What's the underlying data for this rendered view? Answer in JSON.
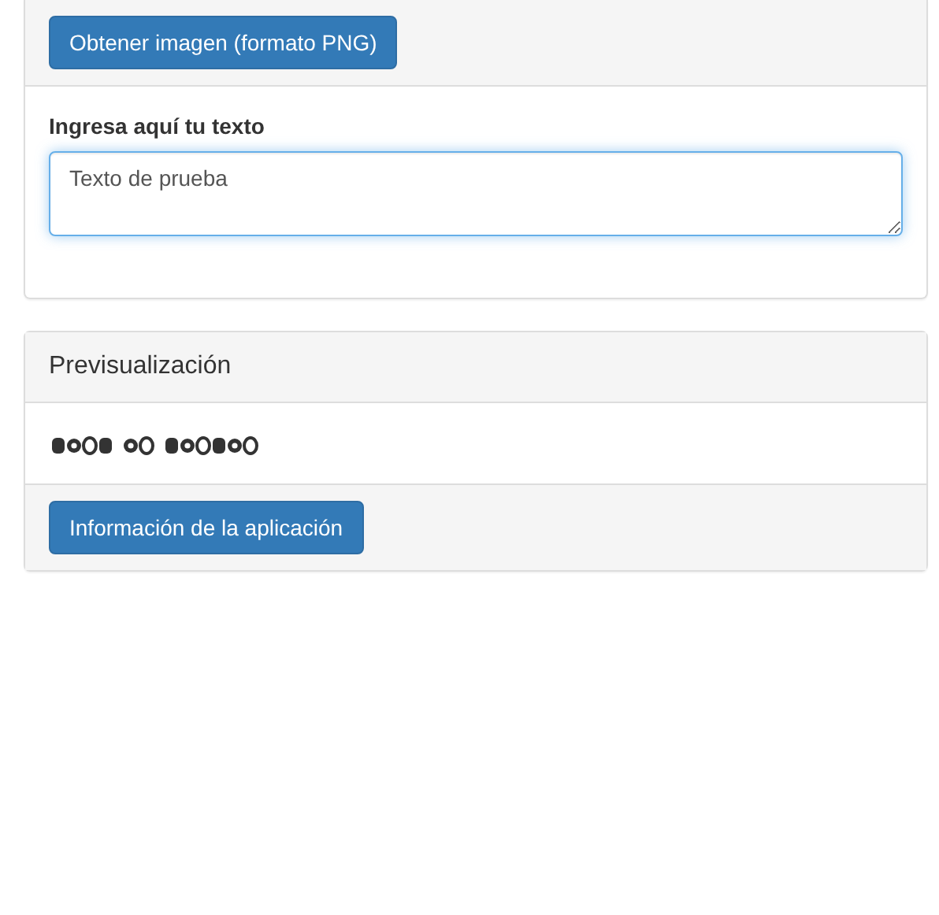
{
  "export_panel": {
    "button": "Obtener imagen (formato PNG)",
    "label": "Ingresa aquí tu texto",
    "textarea": {
      "value": "Texto de prueba",
      "focused": true
    }
  },
  "preview_panel": {
    "title": "Previsualización",
    "button": "Información de la aplicación"
  }
}
